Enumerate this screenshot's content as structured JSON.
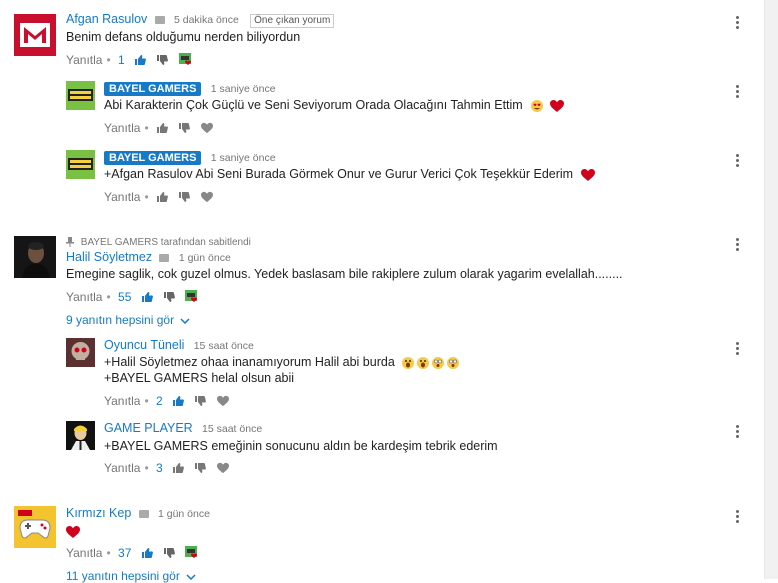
{
  "comments": [
    {
      "author": "Afgan Rasulov",
      "time": "5 dakika önce",
      "featured": "Öne çıkan yorum",
      "text": "Benim defans olduğumu nerden biliyordun",
      "reply": "Yanıtla",
      "likes": "1"
    },
    {
      "author": "BAYEL GAMERS",
      "time": "1 saniye önce",
      "text": "Abi Karakterin Çok Güçlü ve Seni Seviyorum Orada Olacağını Tahmin Ettim",
      "reply": "Yanıtla"
    },
    {
      "author": "BAYEL GAMERS",
      "time": "1 saniye önce",
      "text": "+Afgan Rasulov Abi Seni Burada Görmek Onur ve Gurur Verici Çok Teşekkür Ederim",
      "reply": "Yanıtla"
    },
    {
      "pinned": "BAYEL GAMERS tarafından sabitlendi",
      "author": "Halil Söyletmez",
      "time": "1 gün önce",
      "text": "Emegine saglik, cok guzel olmus. Yedek baslasam bile rakiplere zulum olarak yagarim evelallah........",
      "reply": "Yanıtla",
      "likes": "55",
      "expand": "9 yanıtın hepsini gör"
    },
    {
      "author": "Oyuncu Tüneli",
      "time": "15 saat önce",
      "text1": "+Halil Söyletmez ohaa inanamıyorum Halil abi burda",
      "text2": "+BAYEL GAMERS helal olsun abii",
      "reply": "Yanıtla",
      "likes": "2"
    },
    {
      "author": "GAME PLAYER",
      "time": "15 saat önce",
      "text": "+BAYEL GAMERS emeğinin sonucunu aldın be kardeşim tebrik ederim",
      "reply": "Yanıtla",
      "likes": "3"
    },
    {
      "author": "Kırmızı Kep",
      "time": "1 gün önce",
      "reply": "Yanıtla",
      "likes": "37",
      "expand": "11 yanıtın hepsini gör"
    }
  ],
  "colors": {
    "link": "#167ac6",
    "heart": "#d0021b"
  }
}
